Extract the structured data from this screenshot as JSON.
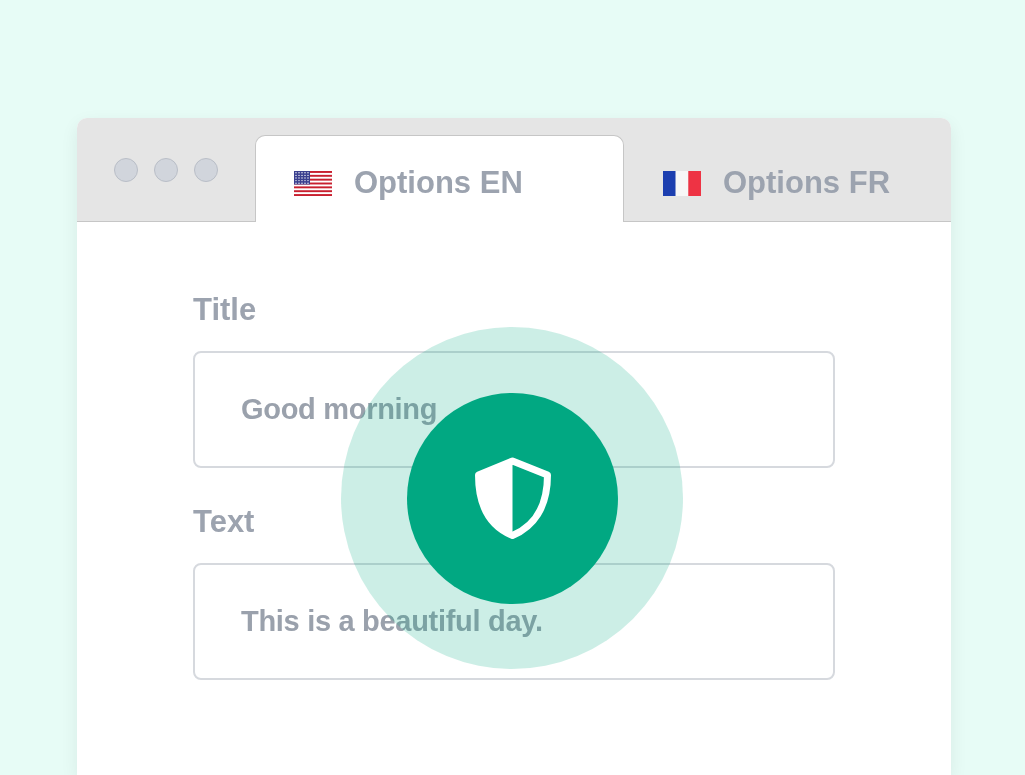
{
  "tabs": [
    {
      "label": "Options EN",
      "kind": "us",
      "selected": true
    },
    {
      "label": "Options FR",
      "kind": "fr",
      "selected": false
    }
  ],
  "fields": [
    {
      "label": "Title",
      "value": "Good morning"
    },
    {
      "label": "Text",
      "value": "This is a beautiful day."
    }
  ]
}
